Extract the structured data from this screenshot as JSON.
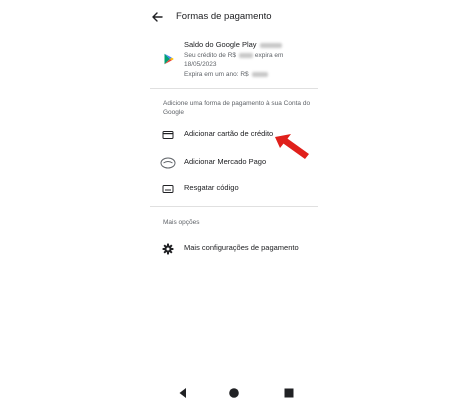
{
  "header": {
    "title": "Formas de pagamento"
  },
  "balance": {
    "title": "Saldo do Google Play",
    "amount_hidden": "",
    "credit_line": "Seu crédito de R$",
    "credit_line_suffix": "expira em",
    "expiry_date": "18/05/2023",
    "year_line": "Expira em um ano: R$"
  },
  "add_section": {
    "heading": "Adicione uma forma de pagamento à sua Conta do Google",
    "items": [
      {
        "label": "Adicionar cartão de crédito",
        "icon": "credit-card-icon"
      },
      {
        "label": "Adicionar Mercado Pago",
        "icon": "mercado-pago-icon"
      },
      {
        "label": "Resgatar código",
        "icon": "redeem-code-icon"
      }
    ]
  },
  "more_section": {
    "heading": "Mais opções",
    "items": [
      {
        "label": "Mais configurações de pagamento",
        "icon": "gear-icon"
      }
    ]
  },
  "annotation": {
    "arrow_color": "#e0201b",
    "icon": "red-arrow-icon"
  },
  "nav": {
    "back": "back-triangle-icon",
    "home": "home-circle-icon",
    "recents": "recents-square-icon"
  }
}
